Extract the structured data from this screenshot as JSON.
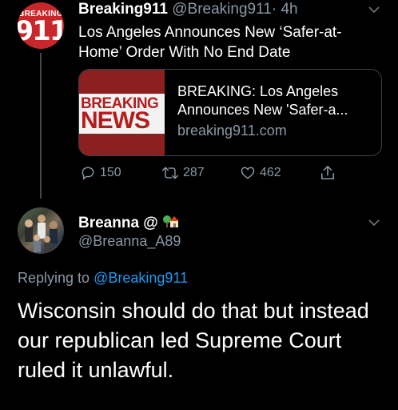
{
  "tweet1": {
    "avatar_top": "BREAKING",
    "avatar_num": "911",
    "name": "Breaking911",
    "handle": "@Breaking911",
    "separator": "·",
    "time": "4h",
    "text": "Los Angeles Announces New ‘Safer-at-Home’ Order With No End Date",
    "card": {
      "image_text_top": "BREAKING",
      "image_text_bottom": "NEWS",
      "title": "BREAKING: Los Angeles Announces New 'Safer-a...",
      "domain": "breaking911.com"
    },
    "actions": {
      "reply_icon": "reply-icon",
      "reply_count": "150",
      "retweet_icon": "retweet-icon",
      "retweet_count": "287",
      "like_icon": "heart-icon",
      "like_count": "462",
      "share_icon": "share-icon"
    }
  },
  "tweet2": {
    "name": "Breanna @",
    "name_emoji": "house-with-garden-emoji",
    "handle": "@Breanna_A89",
    "replying_prefix": "Replying to",
    "replying_to": "@Breaking911",
    "text": "Wisconsin should do that but instead our republican led Supreme Court ruled it unlawful."
  },
  "colors": {
    "background": "#000000",
    "text": "#ffffff",
    "secondary": "#8b98a5",
    "link": "#1d9bf0",
    "brand_red": "#c9272b"
  }
}
